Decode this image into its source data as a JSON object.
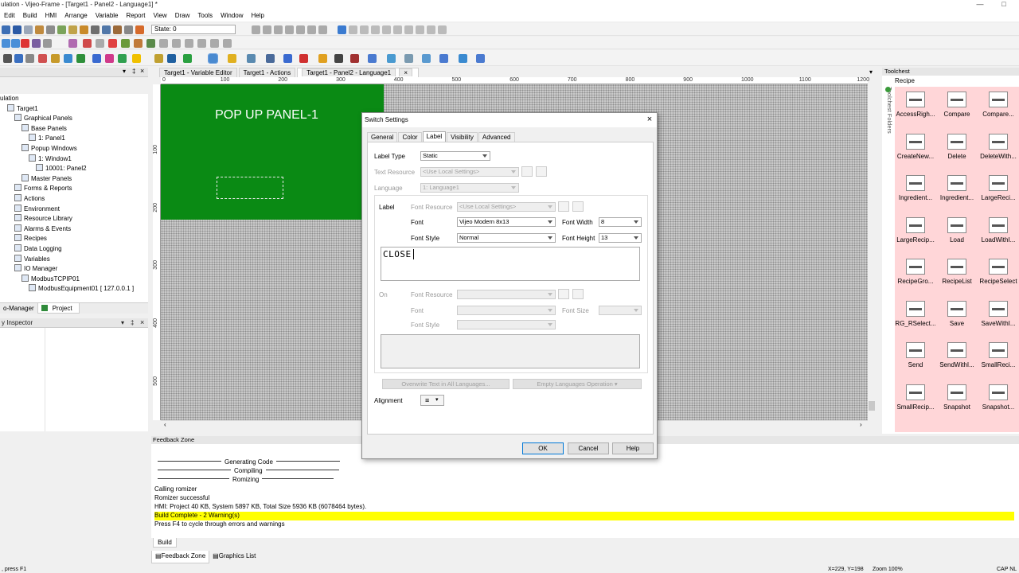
{
  "app": {
    "title": "ulation - Vijeo-Frame - [Target1 - Panel2 - Language1] *"
  },
  "menu": [
    "Edit",
    "Build",
    "HMI",
    "Arrange",
    "Variable",
    "Report",
    "View",
    "Draw",
    "Tools",
    "Window",
    "Help"
  ],
  "toolbar": {
    "state_label": "State: 0"
  },
  "project_tree": {
    "header": "",
    "items": [
      {
        "label": "ulation",
        "indent": 0
      },
      {
        "label": "Target1",
        "indent": 1
      },
      {
        "label": "Graphical Panels",
        "indent": 2
      },
      {
        "label": "Base Panels",
        "indent": 3
      },
      {
        "label": "1: Panel1",
        "indent": 4
      },
      {
        "label": "Popup Windows",
        "indent": 3
      },
      {
        "label": "1: Window1",
        "indent": 4
      },
      {
        "label": "10001: Panel2",
        "indent": 5
      },
      {
        "label": "Master Panels",
        "indent": 3
      },
      {
        "label": "Forms & Reports",
        "indent": 2
      },
      {
        "label": "Actions",
        "indent": 2
      },
      {
        "label": "Environment",
        "indent": 2
      },
      {
        "label": "Resource Library",
        "indent": 2
      },
      {
        "label": "Alarms & Events",
        "indent": 2
      },
      {
        "label": "Recipes",
        "indent": 2
      },
      {
        "label": "Data Logging",
        "indent": 2
      },
      {
        "label": "Variables",
        "indent": 2
      },
      {
        "label": "IO Manager",
        "indent": 2
      },
      {
        "label": "ModbusTCPIP01",
        "indent": 3
      },
      {
        "label": "ModbusEquipment01 [ 127.0.0.1 ]",
        "indent": 4
      }
    ],
    "bottom_tabs": [
      "o-Manager",
      "Project"
    ]
  },
  "inspector": {
    "title": "y Inspector"
  },
  "doc_tabs": [
    "Target1 - Variable Editor",
    "Target1 - Actions",
    "Target1 - Panel2 - Language1"
  ],
  "ruler_h": [
    "0",
    "100",
    "200",
    "300",
    "400",
    "500",
    "600",
    "700",
    "800",
    "900",
    "1000",
    "1100",
    "1200"
  ],
  "ruler_v": [
    "100",
    "200",
    "300",
    "400",
    "500"
  ],
  "panel": {
    "title": "POP UP PANEL-1"
  },
  "toolchest": {
    "title": "Toolchest",
    "category": "Recipe",
    "side_label": "Toolchest Folders",
    "tools": [
      "AccessRigh...",
      "Compare",
      "Compare...",
      "CreateNew...",
      "Delete",
      "DeleteWith...",
      "Ingredient...",
      "Ingredient...",
      "LargeReci...",
      "LargeRecip...",
      "Load",
      "LoadWithI...",
      "RecipeGro...",
      "RecipeList",
      "RecipeSelect",
      "RG_RSelect...",
      "Save",
      "SaveWithI...",
      "Send",
      "SendWithI...",
      "SmallReci...",
      "SmallRecip...",
      "Snapshot",
      "Snapshot..."
    ]
  },
  "feedback": {
    "title": "Feedback Zone",
    "lines": [
      "Generating Code",
      "Compiling",
      "Romizing"
    ],
    "log": [
      "Calling romizer",
      "Romizer successful",
      "HMI: Project 40 KB, System 5897 KB, Total Size 5936 KB (6078464 bytes)."
    ],
    "highlight": "Build Complete - 2 Warning(s)",
    "hint": "Press F4 to cycle through errors and warnings",
    "subtab": "Build",
    "tabs": [
      "Feedback Zone",
      "Graphics List"
    ]
  },
  "status": {
    "left": ", press F1",
    "coords": "X=229, Y=198",
    "zoom": "Zoom 100%",
    "caps": "CAP  NL"
  },
  "dialog": {
    "title": "Switch Settings",
    "tabs": [
      "General",
      "Color",
      "Label",
      "Visibility",
      "Advanced"
    ],
    "label_type_label": "Label Type",
    "label_type": "Static",
    "text_resource_label": "Text Resource",
    "text_resource": "<Use Local Settings>",
    "language_label": "Language",
    "language": "1: Language1",
    "label_section": "Label",
    "font_resource_label": "Font Resource",
    "font_resource": "<Use Local Settings>",
    "font_label": "Font",
    "font": "Vijeo Modern 8x13",
    "font_width_label": "Font Width",
    "font_width": "8",
    "font_style_label": "Font Style",
    "font_style": "Normal",
    "font_height_label": "Font Height",
    "font_height": "13",
    "label_text": "CLOSE",
    "on_section": "On",
    "on_font_resource_label": "Font Resource",
    "on_font_label": "Font",
    "on_font_size_label": "Font Size",
    "on_font_style_label": "Font Style",
    "overwrite_btn": "Overwrite Text in All Languages...",
    "empty_btn": "Empty Languages Operation",
    "alignment_label": "Alignment",
    "alignment_value": "≡",
    "ok": "OK",
    "cancel": "Cancel",
    "help": "Help"
  }
}
